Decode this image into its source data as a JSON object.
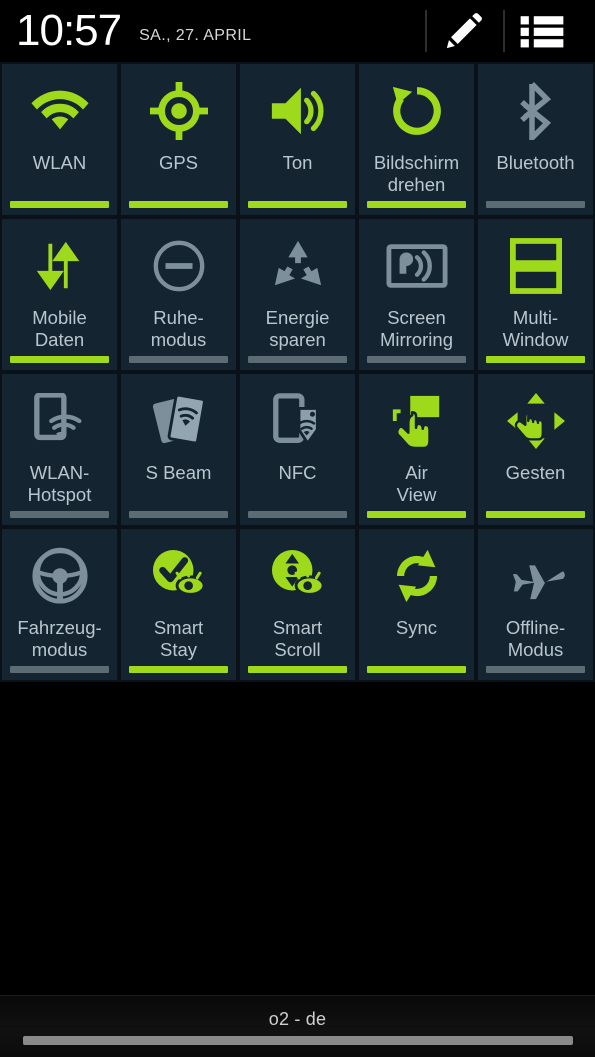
{
  "statusbar": {
    "time": "10:57",
    "date": "SA., 27. APRIL",
    "edit_icon": "pencil-icon",
    "list_icon": "list-icon"
  },
  "toggles": {
    "rows": [
      [
        {
          "label": "WLAN",
          "icon": "wifi-icon",
          "state": "on"
        },
        {
          "label": "GPS",
          "icon": "gps-icon",
          "state": "on"
        },
        {
          "label": "Ton",
          "icon": "sound-icon",
          "state": "on"
        },
        {
          "label": "Bildschirm\ndrehen",
          "icon": "rotate-screen-icon",
          "state": "on"
        },
        {
          "label": "Bluetooth",
          "icon": "bluetooth-icon",
          "state": "off"
        }
      ],
      [
        {
          "label": "Mobile\nDaten",
          "icon": "mobile-data-icon",
          "state": "on"
        },
        {
          "label": "Ruhe-\nmodus",
          "icon": "blocking-mode-icon",
          "state": "off"
        },
        {
          "label": "Energie\nsparen",
          "icon": "power-saving-icon",
          "state": "off"
        },
        {
          "label": "Screen\nMirroring",
          "icon": "screen-mirroring-icon",
          "state": "off"
        },
        {
          "label": "Multi-\nWindow",
          "icon": "multi-window-icon",
          "state": "on"
        }
      ],
      [
        {
          "label": "WLAN-\nHotspot",
          "icon": "wifi-hotspot-icon",
          "state": "off"
        },
        {
          "label": "S Beam",
          "icon": "s-beam-icon",
          "state": "off"
        },
        {
          "label": "NFC",
          "icon": "nfc-icon",
          "state": "off"
        },
        {
          "label": "Air\nView",
          "icon": "air-view-icon",
          "state": "on"
        },
        {
          "label": "Gesten",
          "icon": "gestures-icon",
          "state": "on"
        }
      ],
      [
        {
          "label": "Fahrzeug-\nmodus",
          "icon": "driving-mode-icon",
          "state": "off"
        },
        {
          "label": "Smart\nStay",
          "icon": "smart-stay-icon",
          "state": "on"
        },
        {
          "label": "Smart\nScroll",
          "icon": "smart-scroll-icon",
          "state": "on"
        },
        {
          "label": "Sync",
          "icon": "sync-icon",
          "state": "on"
        },
        {
          "label": "Offline-\nModus",
          "icon": "airplane-icon",
          "state": "off"
        }
      ]
    ]
  },
  "carrier": {
    "name": "o2 - de"
  },
  "colors": {
    "accent_green": "#9ed91c",
    "tile_bg": "#142430",
    "off_gray": "#5d6b75",
    "label_text": "#b9c6cf",
    "panel_bg": "#0a1118"
  }
}
